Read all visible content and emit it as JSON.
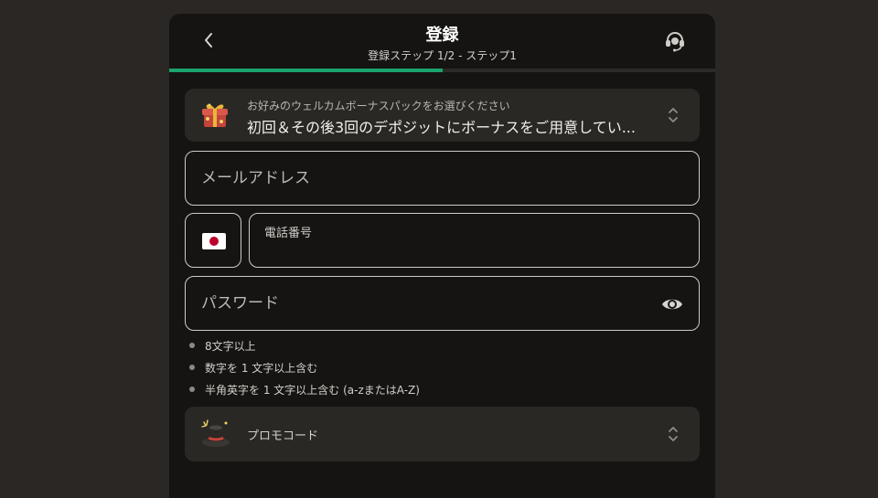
{
  "header": {
    "title": "登録",
    "subtitle": "登録ステップ 1/2 - ステップ1",
    "back_icon": "chevron-left-icon",
    "support_icon": "headset-icon"
  },
  "progress": {
    "value": 0.5,
    "color": "#1aa36c"
  },
  "bonus": {
    "caption": "お好みのウェルカムボーナスパックをお選びください",
    "selected": "初回＆その後3回のデポジットにボーナスをご用意してい...",
    "icon": "gift-box-icon"
  },
  "form": {
    "email_placeholder": "メールアドレス",
    "phone_label": "電話番号",
    "country_flag": "japan-flag-icon",
    "password_placeholder": "パスワード"
  },
  "password_rules": [
    "8文字以上",
    "数字を 1 文字以上含む",
    "半角英字を 1 文字以上含む (a-zまたはA-Z)"
  ],
  "promo": {
    "label": "プロモコード",
    "icon": "magic-hat-icon"
  }
}
